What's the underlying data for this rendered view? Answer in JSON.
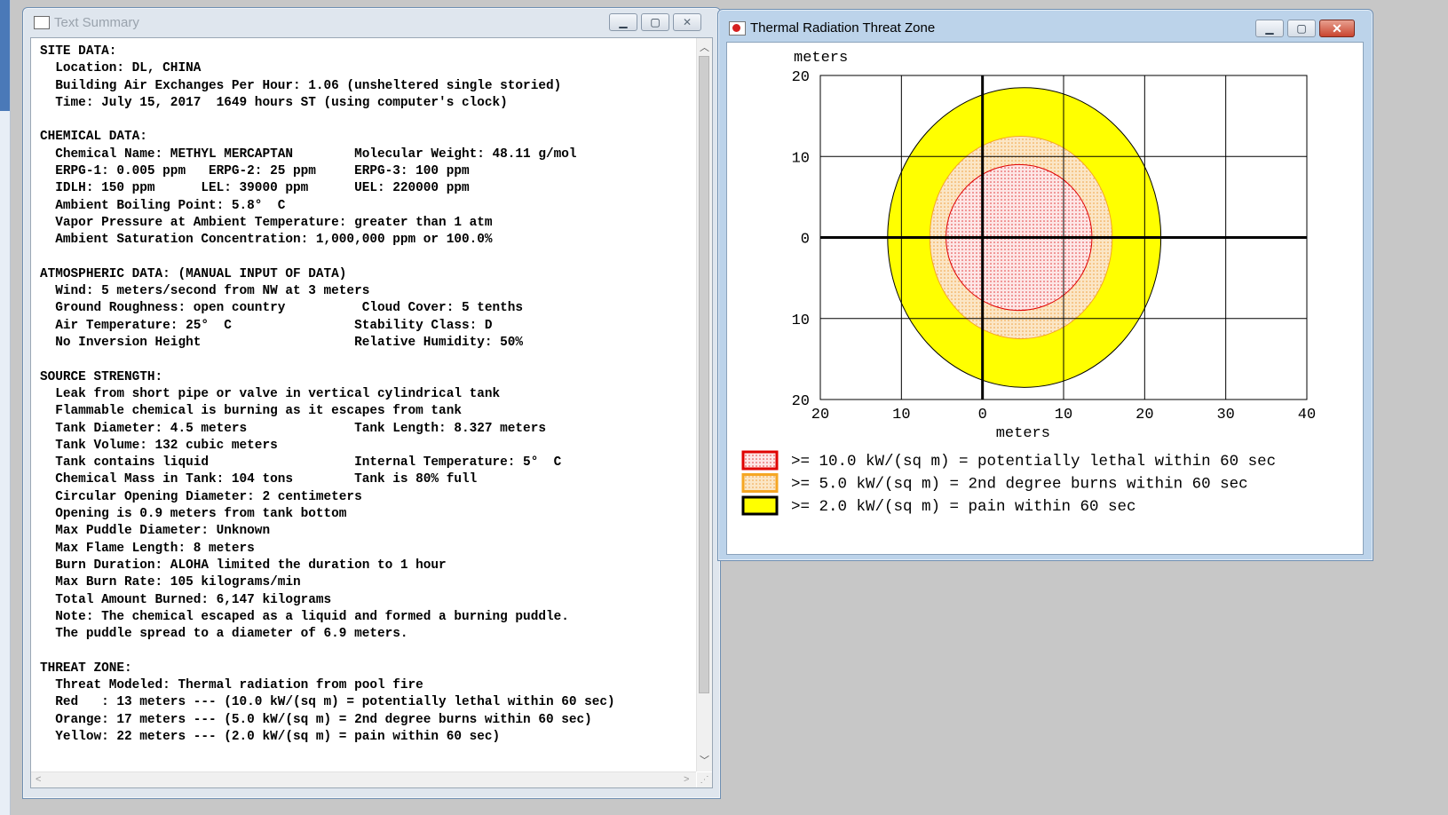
{
  "text_summary": {
    "title": "Text Summary",
    "lines": [
      "SITE DATA:",
      "  Location: DL, CHINA",
      "  Building Air Exchanges Per Hour: 1.06 (unsheltered single storied)",
      "  Time: July 15, 2017  1649 hours ST (using computer's clock)",
      "",
      "CHEMICAL DATA:",
      "  Chemical Name: METHYL MERCAPTAN        Molecular Weight: 48.11 g/mol",
      "  ERPG-1: 0.005 ppm   ERPG-2: 25 ppm     ERPG-3: 100 ppm",
      "  IDLH: 150 ppm      LEL: 39000 ppm      UEL: 220000 ppm",
      "  Ambient Boiling Point: 5.8°  C",
      "  Vapor Pressure at Ambient Temperature: greater than 1 atm",
      "  Ambient Saturation Concentration: 1,000,000 ppm or 100.0%",
      "",
      "ATMOSPHERIC DATA: (MANUAL INPUT OF DATA)",
      "  Wind: 5 meters/second from NW at 3 meters",
      "  Ground Roughness: open country          Cloud Cover: 5 tenths",
      "  Air Temperature: 25°  C                Stability Class: D",
      "  No Inversion Height                    Relative Humidity: 50%",
      "",
      "SOURCE STRENGTH:",
      "  Leak from short pipe or valve in vertical cylindrical tank",
      "  Flammable chemical is burning as it escapes from tank",
      "  Tank Diameter: 4.5 meters              Tank Length: 8.327 meters",
      "  Tank Volume: 132 cubic meters",
      "  Tank contains liquid                   Internal Temperature: 5°  C",
      "  Chemical Mass in Tank: 104 tons        Tank is 80% full",
      "  Circular Opening Diameter: 2 centimeters",
      "  Opening is 0.9 meters from tank bottom",
      "  Max Puddle Diameter: Unknown",
      "  Max Flame Length: 8 meters",
      "  Burn Duration: ALOHA limited the duration to 1 hour",
      "  Max Burn Rate: 105 kilograms/min",
      "  Total Amount Burned: 6,147 kilograms",
      "  Note: The chemical escaped as a liquid and formed a burning puddle.",
      "  The puddle spread to a diameter of 6.9 meters.",
      "",
      "THREAT ZONE:",
      "  Threat Modeled: Thermal radiation from pool fire",
      "  Red   : 13 meters --- (10.0 kW/(sq m) = potentially lethal within 60 sec)",
      "  Orange: 17 meters --- (5.0 kW/(sq m) = 2nd degree burns within 60 sec)",
      "  Yellow: 22 meters --- (2.0 kW/(sq m) = pain within 60 sec)"
    ]
  },
  "threat_window": {
    "title": "Thermal Radiation Threat Zone"
  },
  "chart_data": {
    "type": "threat-zone-plot",
    "xlabel": "meters",
    "ylabel": "meters",
    "xlim": [
      -20,
      40
    ],
    "ylim": [
      -20,
      20
    ],
    "x_ticks": [
      -20,
      -10,
      0,
      10,
      20,
      30,
      40
    ],
    "x_tick_labels": [
      "20",
      "10",
      "0",
      "10",
      "20",
      "30",
      "40"
    ],
    "y_ticks": [
      20,
      10,
      0,
      -10,
      -20
    ],
    "y_tick_labels": [
      "20",
      "10",
      "0",
      "10",
      "20"
    ],
    "grid": true,
    "zones": [
      {
        "name": "Yellow",
        "color": "#ffff00",
        "edge": "#000000",
        "pattern": "solid",
        "x_min": -11.7,
        "x_max": 22,
        "y_half": 18.5
      },
      {
        "name": "Orange",
        "color": "#f6d8a8",
        "edge": "#f5a623",
        "pattern": "dotted",
        "x_min": -6.5,
        "x_max": 16,
        "y_half": 12.5
      },
      {
        "name": "Red",
        "color": "#fbd3d3",
        "edge": "#e00000",
        "pattern": "dotted",
        "x_min": -4.5,
        "x_max": 13.5,
        "y_half": 9
      }
    ],
    "legend": [
      {
        "text": ">= 10.0 kW/(sq m) = potentially lethal within 60 sec",
        "fill": "#fbd3d3",
        "edge": "#e00000"
      },
      {
        "text": ">= 5.0 kW/(sq m) = 2nd degree burns within 60 sec",
        "fill": "#f6d8a8",
        "edge": "#f5a623"
      },
      {
        "text": ">= 2.0 kW/(sq m) = pain within 60 sec",
        "fill": "#ffff00",
        "edge": "#000000"
      }
    ]
  }
}
